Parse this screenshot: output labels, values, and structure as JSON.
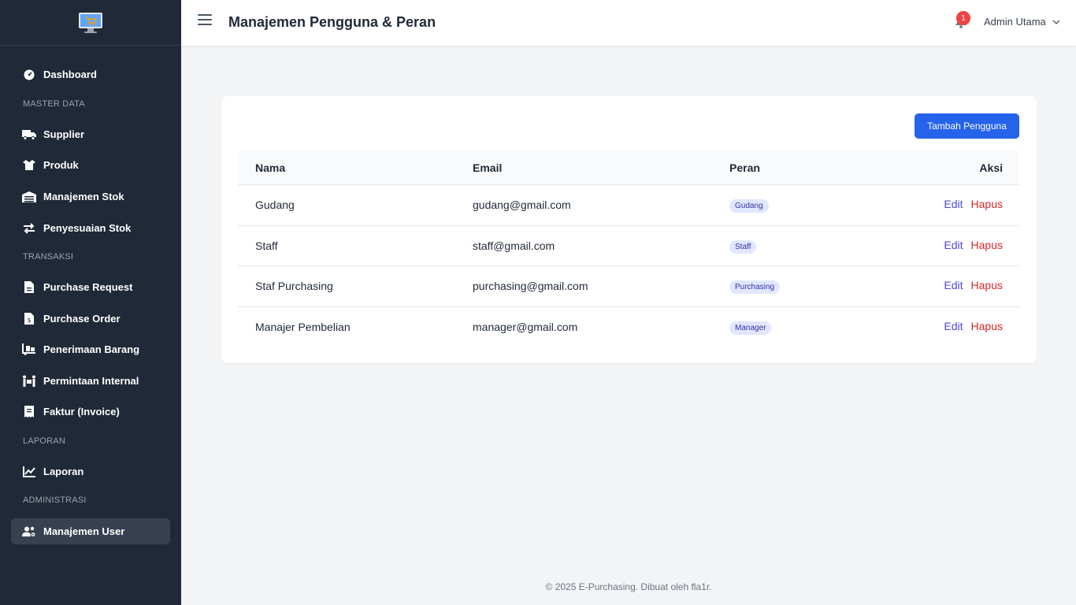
{
  "sidebar": {
    "items": {
      "dashboard": "Dashboard",
      "supplier": "Supplier",
      "produk": "Produk",
      "manajemen_stok": "Manajemen Stok",
      "penyesuaian_stok": "Penyesuaian Stok",
      "purchase_request": "Purchase Request",
      "purchase_order": "Purchase Order",
      "penerimaan_barang": "Penerimaan Barang",
      "permintaan_internal": "Permintaan Internal",
      "faktur": "Faktur (Invoice)",
      "laporan": "Laporan",
      "manajemen_user": "Manajemen User"
    },
    "sections": {
      "master_data": "MASTER DATA",
      "transaksi": "TRANSAKSI",
      "laporan": "LAPORAN",
      "administrasi": "ADMINISTRASI"
    },
    "active": "manajemen_user"
  },
  "header": {
    "title": "Manajemen Pengguna & Peran",
    "notification_count": "1",
    "user_name": "Admin Utama"
  },
  "card": {
    "add_button": "Tambah Pengguna",
    "columns": {
      "nama": "Nama",
      "email": "Email",
      "peran": "Peran",
      "aksi": "Aksi"
    },
    "rows": [
      {
        "nama": "Gudang",
        "email": "gudang@gmail.com",
        "peran": "Gudang",
        "edit": "Edit",
        "hapus": "Hapus"
      },
      {
        "nama": "Staff",
        "email": "staff@gmail.com",
        "peran": "Staff",
        "edit": "Edit",
        "hapus": "Hapus"
      },
      {
        "nama": "Staf Purchasing",
        "email": "purchasing@gmail.com",
        "peran": "Purchasing",
        "edit": "Edit",
        "hapus": "Hapus"
      },
      {
        "nama": "Manajer Pembelian",
        "email": "manager@gmail.com",
        "peran": "Manager",
        "edit": "Edit",
        "hapus": "Hapus"
      }
    ]
  },
  "footer": {
    "text": "© 2025 E-Purchasing. Dibuat oleh fla1r."
  },
  "colors": {
    "sidebar_bg": "#1f2937",
    "primary": "#2563eb",
    "danger": "#dc2626",
    "badge_bg": "#e0e7ff"
  }
}
